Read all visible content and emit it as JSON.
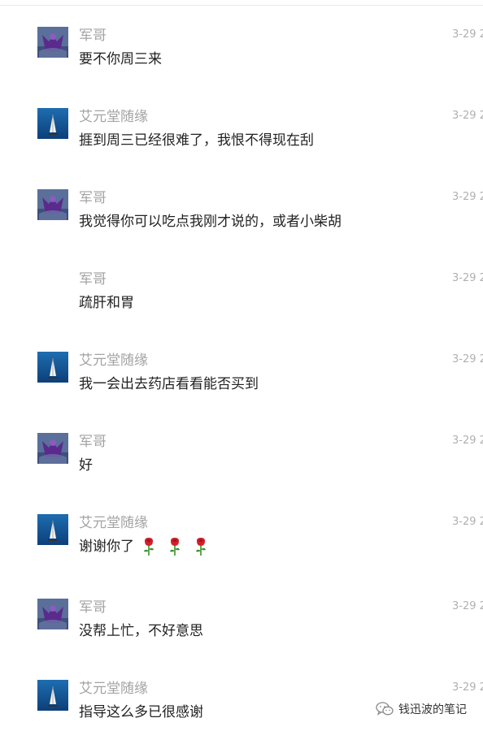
{
  "conversation": {
    "messages": [
      {
        "sender": "军哥",
        "avatar": "purple-figure-avatar",
        "time": "3-29 2",
        "text": "要不你周三来"
      },
      {
        "sender": "艾元堂随缘",
        "avatar": "sailboat-avatar",
        "time": "3-29 2",
        "text": "捱到周三已经很难了，我恨不得现在刮"
      },
      {
        "sender": "军哥",
        "avatar": "purple-figure-avatar",
        "time": "3-29 2",
        "text": "我觉得你可以吃点我刚才说的，或者小柴胡"
      },
      {
        "sender": "军哥",
        "avatar": "none",
        "time": "3-29 2",
        "text": "疏肝和胃"
      },
      {
        "sender": "艾元堂随缘",
        "avatar": "sailboat-avatar",
        "time": "3-29 2",
        "text": "我一会出去药店看看能否买到"
      },
      {
        "sender": "军哥",
        "avatar": "purple-figure-avatar",
        "time": "3-29 2",
        "text": "好"
      },
      {
        "sender": "艾元堂随缘",
        "avatar": "sailboat-avatar",
        "time": "3-29 2",
        "text": "谢谢你了",
        "emoji": [
          "rose-icon",
          "rose-icon",
          "rose-icon"
        ]
      },
      {
        "sender": "军哥",
        "avatar": "purple-figure-avatar",
        "time": "3-29 2",
        "text": "没帮上忙，不好意思"
      },
      {
        "sender": "艾元堂随缘",
        "avatar": "sailboat-avatar",
        "time": "3-29 2",
        "text": "指导这么多已很感谢"
      }
    ]
  },
  "watermark": {
    "icon": "wechat-icon",
    "text": "钱迅波的笔记"
  },
  "colors": {
    "sender": "#a3a3a3",
    "time": "#b0b0b0",
    "text": "#222222",
    "rose_petal": "#d0202a",
    "rose_stem": "#3e8f2a"
  }
}
